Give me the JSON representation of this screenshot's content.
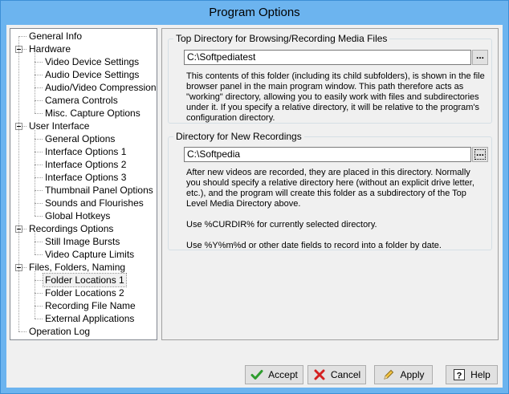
{
  "window": {
    "title": "Program Options"
  },
  "tree": [
    {
      "label": "General Info",
      "level": 0
    },
    {
      "label": "Hardware",
      "level": 0,
      "expanded": true
    },
    {
      "label": "Video Device Settings",
      "level": 1
    },
    {
      "label": "Audio Device Settings",
      "level": 1
    },
    {
      "label": "Audio/Video Compression",
      "level": 1
    },
    {
      "label": "Camera Controls",
      "level": 1
    },
    {
      "label": "Misc. Capture Options",
      "level": 1
    },
    {
      "label": "User Interface",
      "level": 0,
      "expanded": true
    },
    {
      "label": "General Options",
      "level": 1
    },
    {
      "label": "Interface Options 1",
      "level": 1
    },
    {
      "label": "Interface Options 2",
      "level": 1
    },
    {
      "label": "Interface Options 3",
      "level": 1
    },
    {
      "label": "Thumbnail Panel Options",
      "level": 1
    },
    {
      "label": "Sounds and Flourishes",
      "level": 1
    },
    {
      "label": "Global Hotkeys",
      "level": 1
    },
    {
      "label": "Recordings Options",
      "level": 0,
      "expanded": true
    },
    {
      "label": "Still Image Bursts",
      "level": 1
    },
    {
      "label": "Video Capture Limits",
      "level": 1
    },
    {
      "label": "Files, Folders, Naming",
      "level": 0,
      "expanded": true
    },
    {
      "label": "Folder Locations 1",
      "level": 1,
      "selected": true
    },
    {
      "label": "Folder Locations 2",
      "level": 1
    },
    {
      "label": "Recording File Name",
      "level": 1
    },
    {
      "label": "External Applications",
      "level": 1
    },
    {
      "label": "Operation Log",
      "level": 0
    }
  ],
  "top_dir": {
    "title": "Top Directory for Browsing/Recording Media Files",
    "value": "C:\\Softpediatest",
    "browse_label": "...",
    "description": "This contents of this folder (including its child subfolders), is shown in the file browser panel in the main program window.  This path therefore acts as \"working\" directory, allowing you to easily work with files and subdirectories under it.  If you specify a relative directory, it will be relative to the program's configuration directory."
  },
  "new_rec": {
    "title": "Directory for New Recordings",
    "value": "C:\\Softpedia",
    "browse_label": "...",
    "description_1": "After new videos are recorded, they are placed in this directory. Normally you should specify a relative directory here (without an explicit drive letter, etc.), and the program will create this folder as a subdirectory of the Top Level Media Directory above.",
    "description_2": "Use %CURDIR% for currently selected directory.",
    "description_3": "Use %Y%m%d or other date fields to record into a folder by date."
  },
  "buttons": {
    "accept": "Accept",
    "cancel": "Cancel",
    "apply": "Apply",
    "help": "Help"
  }
}
